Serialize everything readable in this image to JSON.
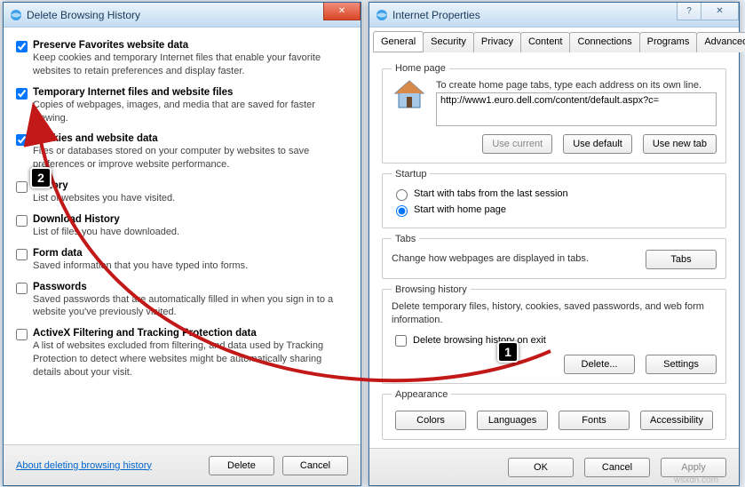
{
  "delete_dialog": {
    "title": "Delete Browsing History",
    "items": [
      {
        "label": "Preserve Favorites website data",
        "desc": "Keep cookies and temporary Internet files that enable your favorite websites to retain preferences and display faster.",
        "checked": true
      },
      {
        "label": "Temporary Internet files and website files",
        "desc": "Copies of webpages, images, and media that are saved for faster viewing.",
        "checked": true
      },
      {
        "label": "Cookies and website data",
        "desc": "Files or databases stored on your computer by websites to save preferences or improve website performance.",
        "checked": true
      },
      {
        "label": "History",
        "desc": "List of websites you have visited.",
        "checked": false
      },
      {
        "label": "Download History",
        "desc": "List of files you have downloaded.",
        "checked": false
      },
      {
        "label": "Form data",
        "desc": "Saved information that you have typed into forms.",
        "checked": false
      },
      {
        "label": "Passwords",
        "desc": "Saved passwords that are automatically filled in when you sign in to a website you've previously visited.",
        "checked": false
      },
      {
        "label": "ActiveX Filtering and Tracking Protection data",
        "desc": "A list of websites excluded from filtering, and data used by Tracking Protection to detect where websites might be automatically sharing details about your visit.",
        "checked": false
      }
    ],
    "about_link": "About deleting browsing history",
    "delete_btn": "Delete",
    "cancel_btn": "Cancel"
  },
  "props_dialog": {
    "title": "Internet Properties",
    "tabs": [
      "General",
      "Security",
      "Privacy",
      "Content",
      "Connections",
      "Programs",
      "Advanced"
    ],
    "homepage": {
      "legend": "Home page",
      "hint": "To create home page tabs, type each address on its own line.",
      "url": "http://www1.euro.dell.com/content/default.aspx?c=",
      "use_current": "Use current",
      "use_default": "Use default",
      "use_new_tab": "Use new tab"
    },
    "startup": {
      "legend": "Startup",
      "opt1": "Start with tabs from the last session",
      "opt2": "Start with home page"
    },
    "tabs_section": {
      "legend": "Tabs",
      "desc": "Change how webpages are displayed in tabs.",
      "btn": "Tabs"
    },
    "history": {
      "legend": "Browsing history",
      "desc": "Delete temporary files, history, cookies, saved passwords, and web form information.",
      "del_exit": "Delete browsing history on exit",
      "delete_btn": "Delete...",
      "settings_btn": "Settings"
    },
    "appearance": {
      "legend": "Appearance",
      "colors": "Colors",
      "languages": "Languages",
      "fonts": "Fonts",
      "accessibility": "Accessibility"
    },
    "ok": "OK",
    "cancel": "Cancel",
    "apply": "Apply"
  },
  "annotations": {
    "step1": "1",
    "step2": "2"
  },
  "watermark": "wsxdn.com"
}
